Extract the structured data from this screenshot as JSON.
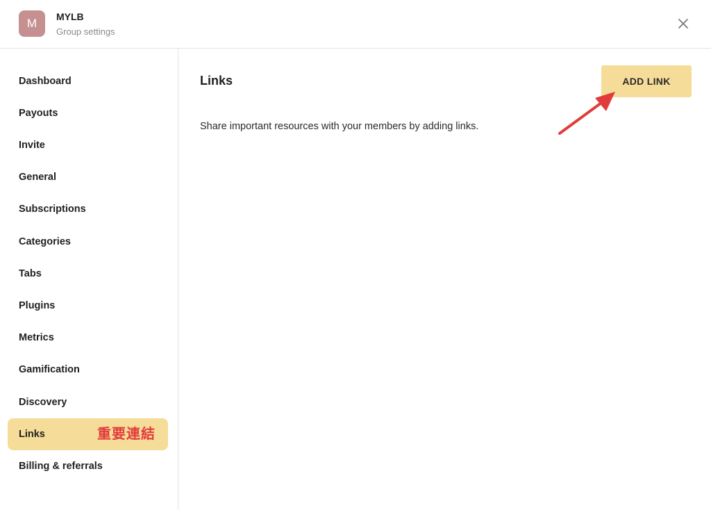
{
  "header": {
    "avatar_letter": "M",
    "group_name": "MYLB",
    "subtitle": "Group settings",
    "close_icon": "close-icon"
  },
  "sidebar": {
    "items": [
      {
        "label": "Dashboard"
      },
      {
        "label": "Payouts"
      },
      {
        "label": "Invite"
      },
      {
        "label": "General"
      },
      {
        "label": "Subscriptions"
      },
      {
        "label": "Categories"
      },
      {
        "label": "Tabs"
      },
      {
        "label": "Plugins"
      },
      {
        "label": "Metrics"
      },
      {
        "label": "Gamification"
      },
      {
        "label": "Discovery"
      },
      {
        "label": "Links",
        "active": true,
        "annotation": "重要連結"
      },
      {
        "label": "Billing & referrals"
      }
    ]
  },
  "main": {
    "title": "Links",
    "add_button_label": "ADD LINK",
    "description": "Share important resources with your members by adding links."
  },
  "colors": {
    "accent": "#f5dc98",
    "avatar": "#c69090",
    "annotation": "#e23b3b"
  }
}
